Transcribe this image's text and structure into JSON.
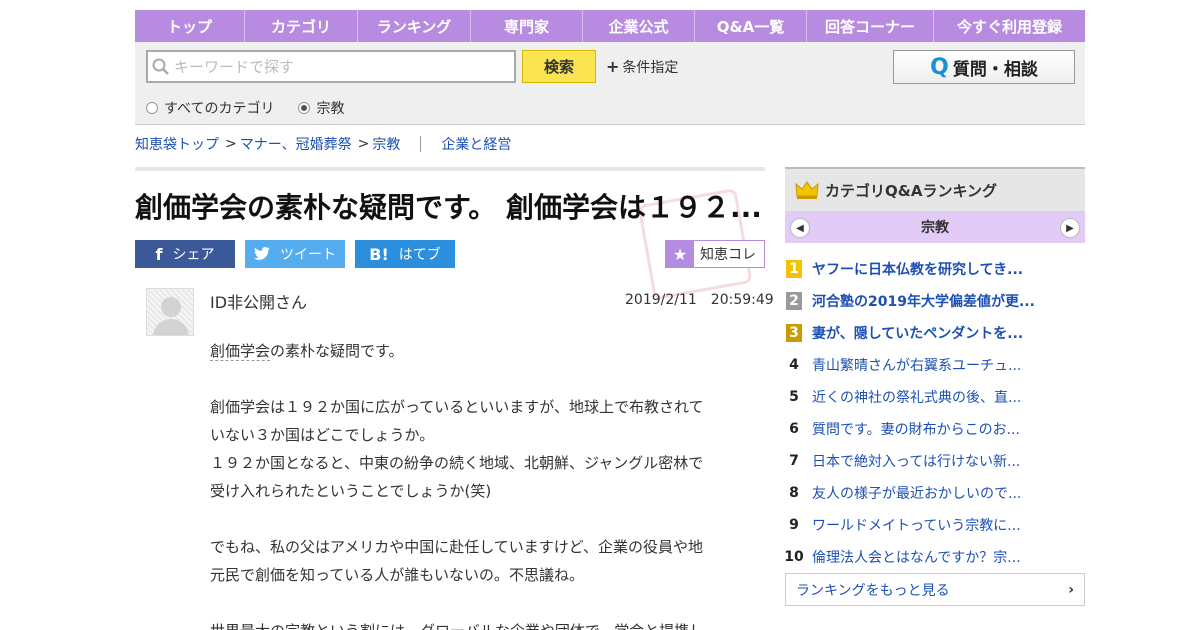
{
  "nav": [
    "トップ",
    "カテゴリ",
    "ランキング",
    "専門家",
    "企業公式",
    "Q&A一覧",
    "回答コーナー",
    "今すぐ利用登録"
  ],
  "search": {
    "placeholder": "キーワードで探す",
    "button": "検索",
    "condition": "条件指定",
    "radio_all": "すべてのカテゴリ",
    "radio_current": "宗教",
    "selected": "宗教"
  },
  "ask_button": "質問・相談",
  "breadcrumb": {
    "home": "知恵袋トップ",
    "cat1": "マナー、冠婚葬祭",
    "cat2": "宗教",
    "other": "企業と経営"
  },
  "question": {
    "title": "創価学会の素朴な疑問です。 創価学会は１９２...",
    "share_fb": "シェア",
    "share_tw": "ツイート",
    "share_hb": "はてブ",
    "chiekore": "知恵コレ",
    "author": "ID非公開さん",
    "date": "2019/2/11　20:59:49",
    "body_kw": "創価学会",
    "body_l1": "の素朴な疑問です。",
    "body_l2": "創価学会は１９２か国に広がっているといいますが、地球上で布教されて",
    "body_l3": "いない３か国はどこでしょうか。",
    "body_l4": "１９２か国となると、中東の紛争の続く地域、北朝鮮、ジャングル密林で",
    "body_l5": "受け入れられたということでしょうか(笑)",
    "body_l6": "でもね、私の父はアメリカや中国に赴任していますけど、企業の役員や地",
    "body_l7": "元民で創価を知っている人が誰もいないの。不思議ね。",
    "body_l8": "世界最大の宗教という割には、グローバルな企業や団体で、学会と提携し"
  },
  "ranking": {
    "header": "カテゴリQ&Aランキング",
    "category": "宗教",
    "items": [
      {
        "num": "1",
        "text": "ヤフーに日本仏教を研究してき..."
      },
      {
        "num": "2",
        "text": "河合塾の2019年大学偏差値が更..."
      },
      {
        "num": "3",
        "text": "妻が、隠していたペンダントを..."
      },
      {
        "num": "4",
        "text": "青山繁晴さんが右翼系ユーチュ..."
      },
      {
        "num": "5",
        "text": "近くの神社の祭礼式典の後、直..."
      },
      {
        "num": "6",
        "text": "質問です。妻の財布からこのお..."
      },
      {
        "num": "7",
        "text": "日本で絶対入っては行けない新..."
      },
      {
        "num": "8",
        "text": "友人の様子が最近おかしいので..."
      },
      {
        "num": "9",
        "text": "ワールドメイトっていう宗教に..."
      },
      {
        "num": "10",
        "text": "倫理法人会とはなんですか？宗..."
      }
    ],
    "more": "ランキングをもっと見る"
  }
}
